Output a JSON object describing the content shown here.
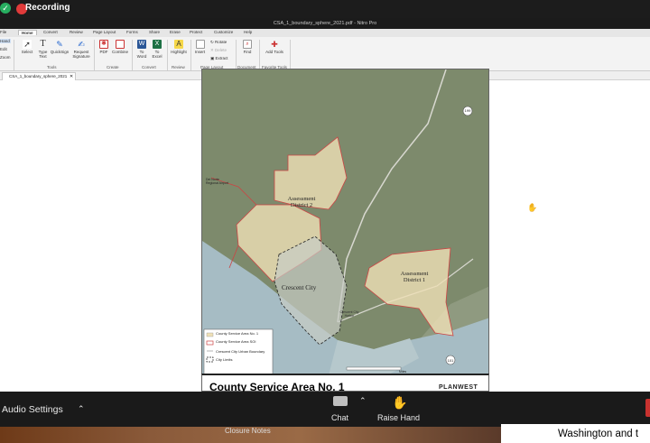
{
  "recording": {
    "label": "Recording"
  },
  "window": {
    "title": "CSA_1_boundary_sphere_2021.pdf - Nitro Pro"
  },
  "ribbon_tabs": [
    "File",
    "Home",
    "Convert",
    "Review",
    "Page Layout",
    "Forms",
    "Share",
    "Erase",
    "Protect",
    "Customize",
    "Help"
  ],
  "ribbon": {
    "left_menu": [
      "Hand",
      "Edit",
      "Zoom"
    ],
    "buttons": {
      "select": "Select",
      "type_text": "Type Text",
      "quicksign": "QuickSign",
      "request_signature": "Request Signature",
      "pdf": "PDF",
      "combine": "Combine",
      "to_word": "To Word",
      "to_excel": "To Excel",
      "highlight": "Highlight",
      "insert": "Insert",
      "rotate": "Rotate",
      "delete": "Delete",
      "extract": "Extract",
      "find": "Find",
      "add_tools": "Add Tools"
    },
    "groups": [
      "Tools",
      "Create",
      "Convert",
      "Review",
      "Page Layout",
      "Document",
      "Favorite Tools"
    ]
  },
  "document_tab": {
    "label": "CSA_1_boundary_sphere_2021"
  },
  "map": {
    "labels": {
      "district2": "Assessment District 2",
      "district1": "Assessment District 1",
      "crescent": "Crescent City",
      "harbor": "Crescent City Harbor",
      "route199": "199",
      "route101": "101",
      "park": "Del Norte Regional Airport",
      "scale": "Miles"
    },
    "legend": [
      "County Service Area No. 1",
      "County Service Area SOI",
      "Crescent City Urban Boundary",
      "City Limits"
    ],
    "title": "County Service Area No. 1",
    "brand": "PLANWEST"
  },
  "zoom_bar": {
    "audio_settings": "Audio Settings",
    "chat": "Chat",
    "raise_hand": "Raise Hand"
  },
  "bottom": {
    "closure_notes": "Closure Notes",
    "washington": "Washington and t"
  }
}
